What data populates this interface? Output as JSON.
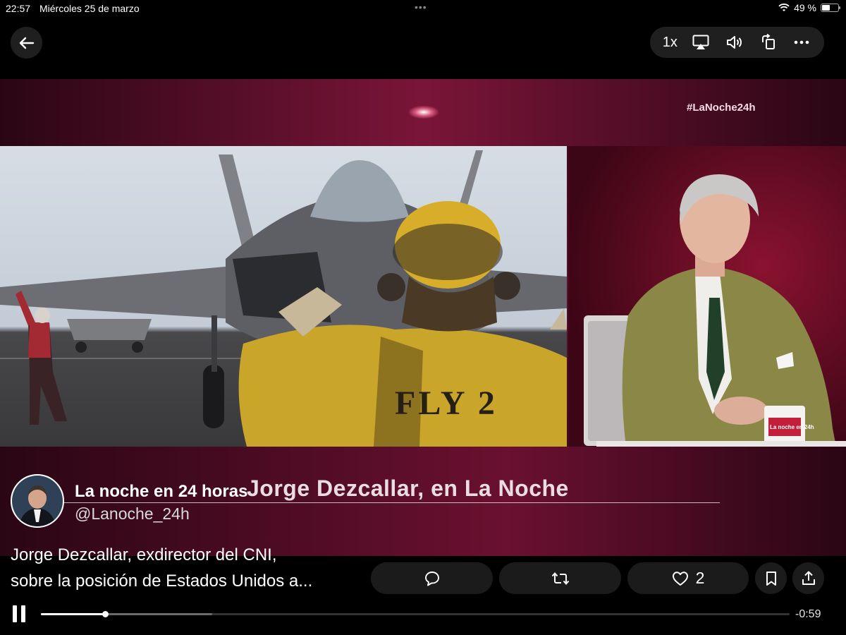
{
  "status_bar": {
    "time": "22:57",
    "date": "Miércoles 25 de marzo",
    "battery": "49 %",
    "battery_level": 0.49
  },
  "player_controls": {
    "speed": "1x",
    "icons": [
      "back-arrow-icon",
      "airplay-icon",
      "volume-icon",
      "rotate-icon",
      "more-icon"
    ]
  },
  "video": {
    "hashtag": "#LaNoche24h",
    "lower_third": "Jorge Dezcallar, en La Noche",
    "vest_text": "FLY 2",
    "mug_text": "La noche en 24h"
  },
  "tweet": {
    "author_name": "La noche en 24 horas",
    "author_handle": "@Lanoche_24h",
    "text_line1": "Jorge Dezcallar, exdirector del CNI,",
    "text_line2": "sobre la posición de Estados Unidos a..."
  },
  "actions": {
    "reply_icon": "reply-icon",
    "repost_icon": "repost-icon",
    "like_icon": "heart-icon",
    "like_count": "2",
    "bookmark_icon": "bookmark-icon",
    "share_icon": "share-icon"
  },
  "playback": {
    "remaining": "-0:59",
    "played_fraction": 0.086,
    "buffered_fraction": 0.229
  },
  "colors": {
    "accent": "#7a1538",
    "background": "#000000"
  }
}
